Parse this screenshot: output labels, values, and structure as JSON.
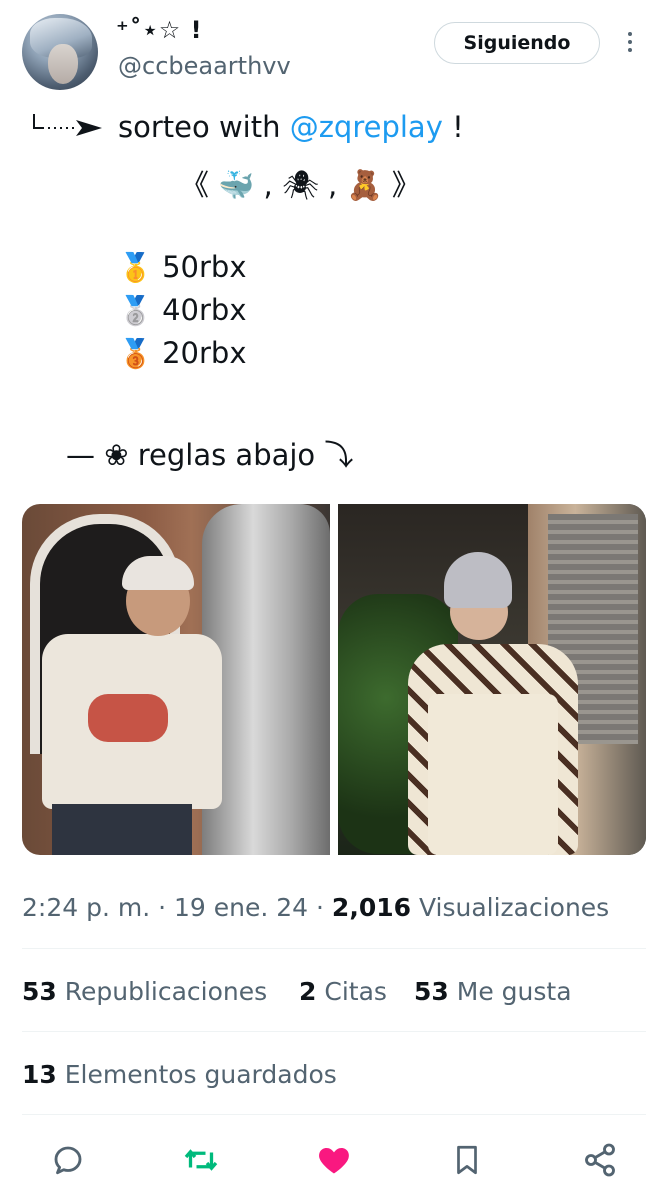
{
  "author": {
    "display_name": "⁺˚⋆☆ !",
    "handle": "@ccbeaarthvv",
    "follow_label": "Siguiendo"
  },
  "tweet": {
    "line1_prefix": "sorteo with ",
    "line1_mention": "@zqreplay",
    "line1_suffix": " !",
    "line2": "《 🐳 , 🕷 , 🧸 》",
    "prizes": [
      {
        "medal": "🥇",
        "text": "50rbx"
      },
      {
        "medal": "🥈",
        "text": "40rbx"
      },
      {
        "medal": "🥉",
        "text": "20rbx"
      }
    ],
    "rules": "— ❀ reglas abajo ⤵"
  },
  "meta": {
    "time": "2:24 p. m.",
    "date": "19 ene. 24",
    "views_count": "2,016",
    "views_label": "Visualizaciones"
  },
  "stats": {
    "reposts_count": "53",
    "reposts_label": "Republicaciones",
    "quotes_count": "2",
    "quotes_label": "Citas",
    "likes_count": "53",
    "likes_label": "Me gusta",
    "bookmarks_count": "13",
    "bookmarks_label": "Elementos guardados"
  },
  "actions": {
    "reply_icon": "reply-icon",
    "repost_icon": "repost-icon",
    "like_icon": "heart-icon",
    "bookmark_icon": "bookmark-icon",
    "share_icon": "share-icon"
  },
  "colors": {
    "accent": "#1d9bf0",
    "repost_active": "#00ba7c",
    "like_active": "#f91880",
    "muted": "#536471"
  }
}
